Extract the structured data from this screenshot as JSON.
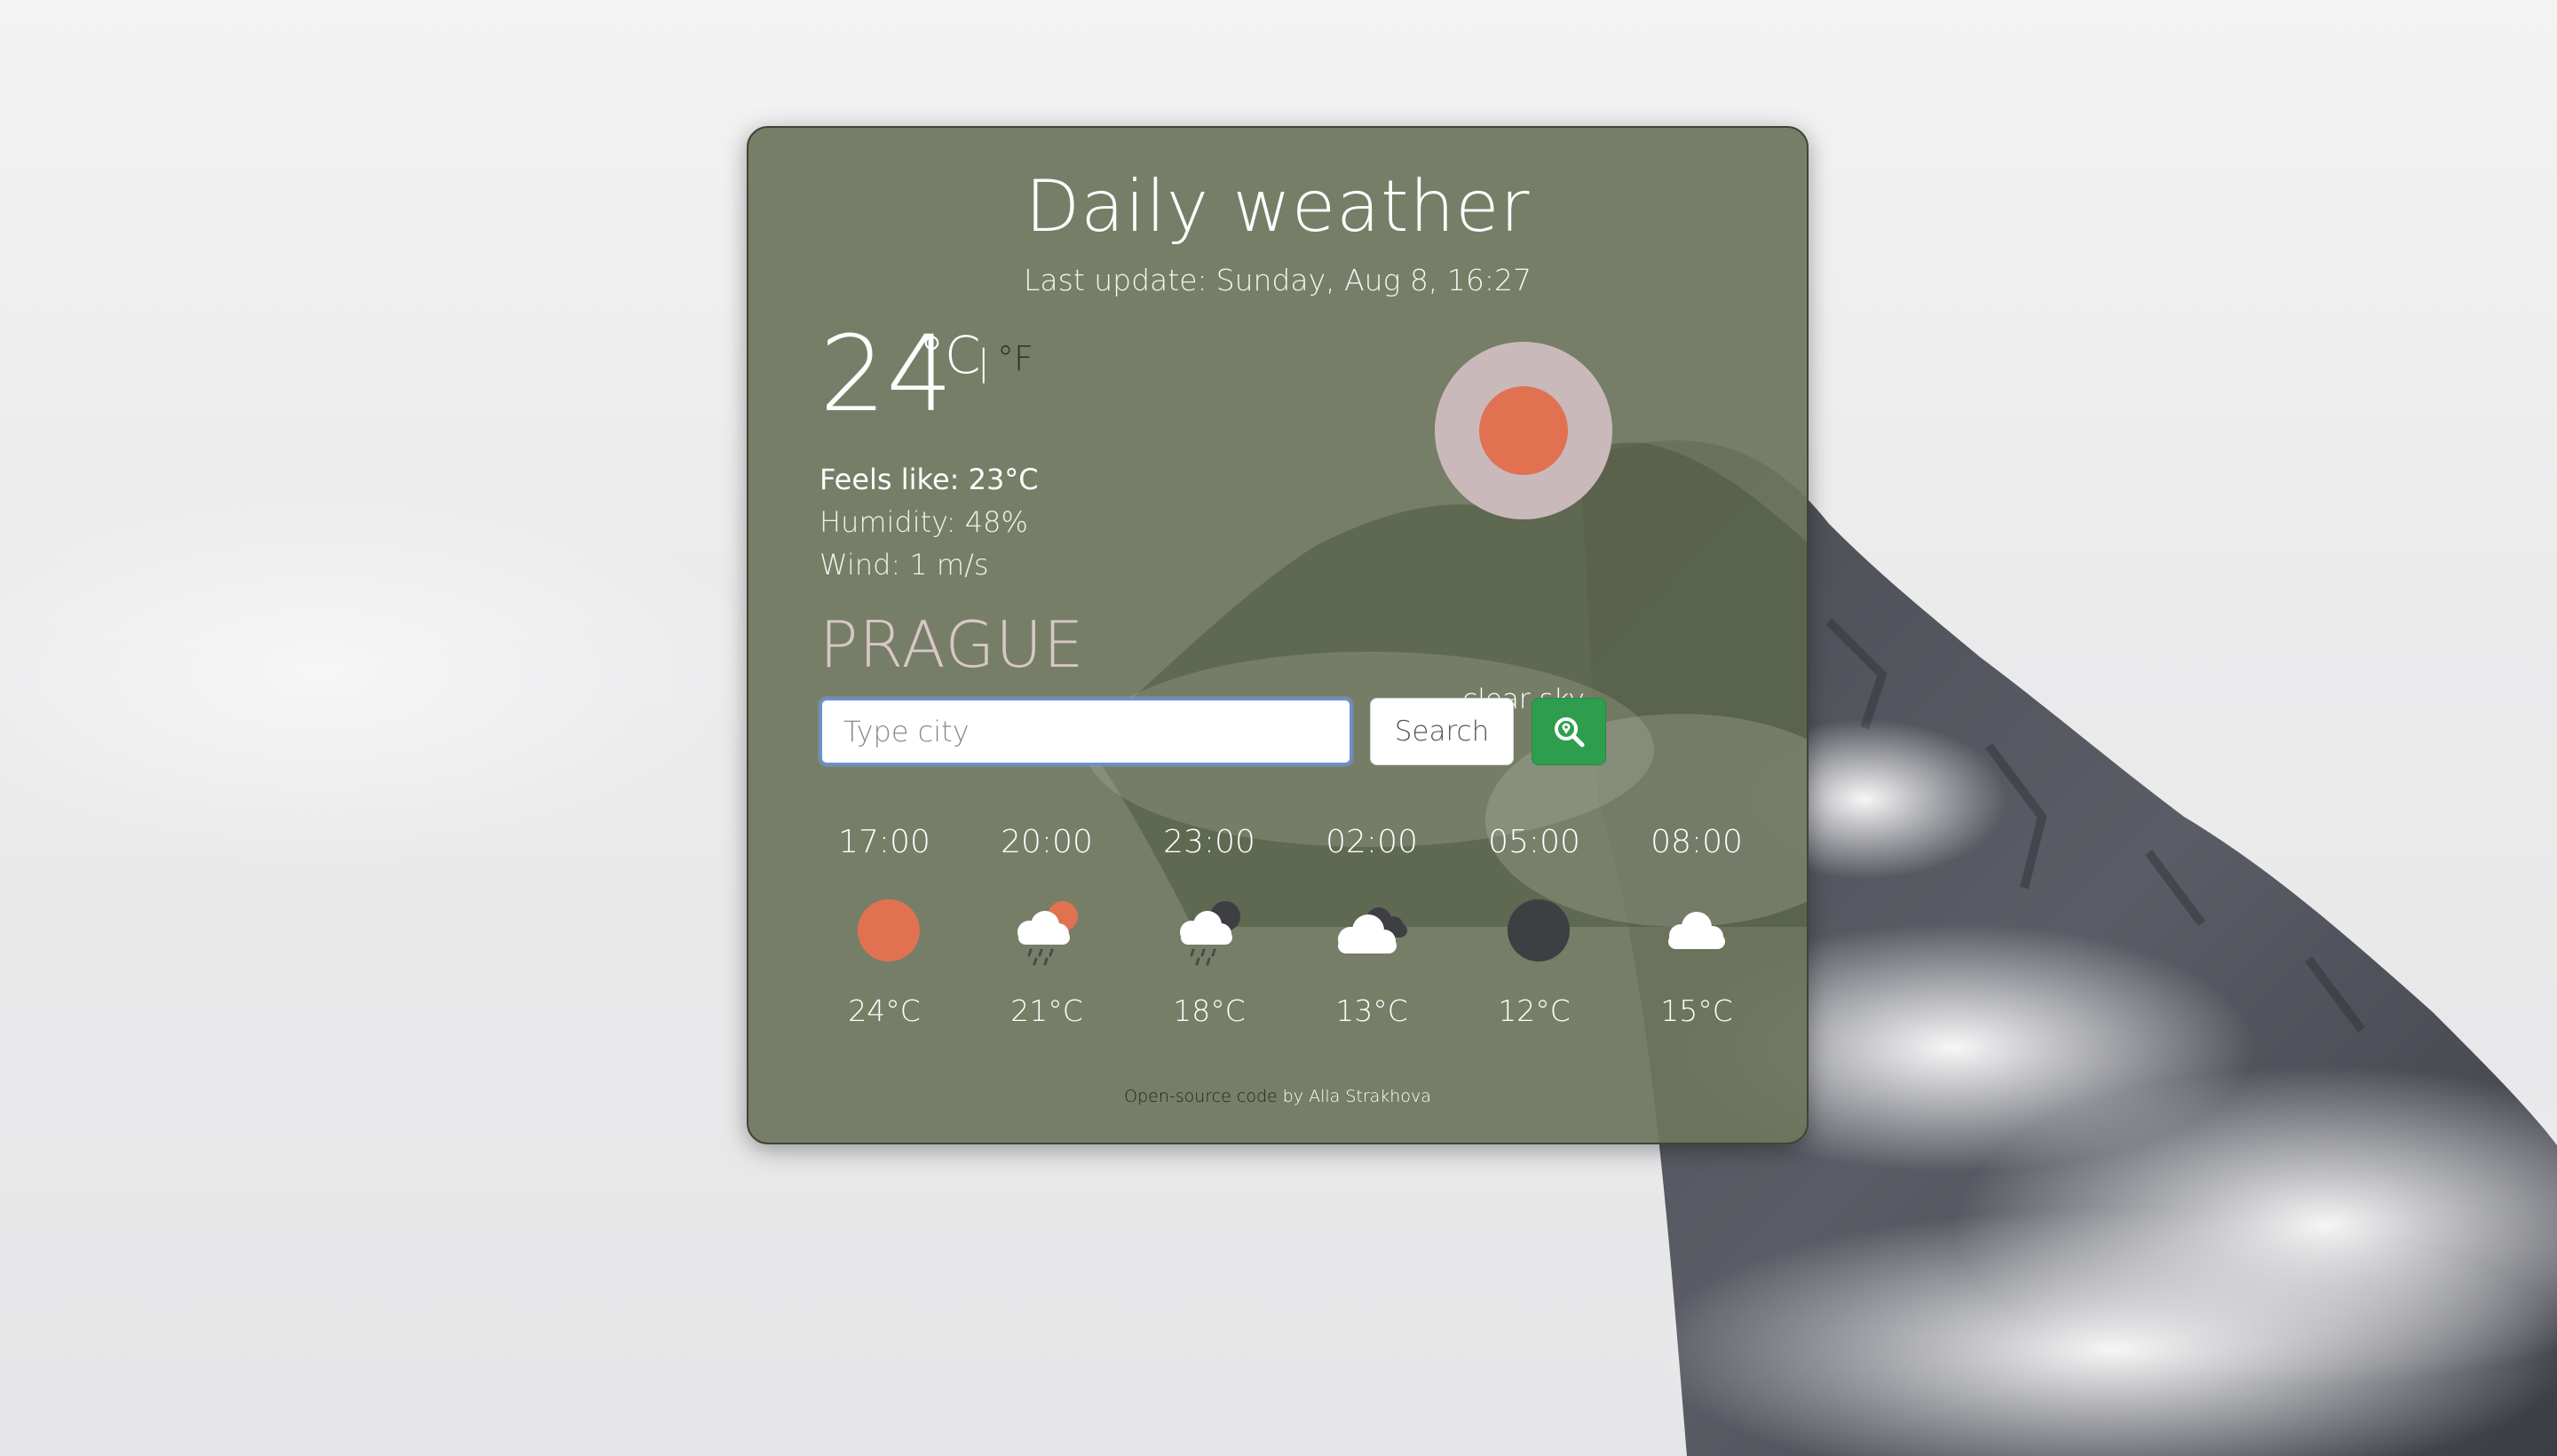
{
  "app": {
    "title": "Daily weather",
    "last_update_label": "Last update:",
    "last_update_value": "Sunday, Aug 8, 16:27"
  },
  "current": {
    "temperature": "24",
    "unit_celsius": "°C",
    "unit_separator": "|",
    "unit_fahrenheit": "°F",
    "feels_like": "Feels like: 23°C",
    "humidity": "Humidity: 48%",
    "wind": "Wind: 1 m/s",
    "description": "clear sky",
    "icon": "sun-icon"
  },
  "city": "PRAGUE",
  "search": {
    "placeholder": "Type city",
    "value": "",
    "button_label": "Search",
    "location_icon": "search-location-icon"
  },
  "forecast": [
    {
      "time": "17:00",
      "temp": "24°C",
      "icon": "sun-icon"
    },
    {
      "time": "20:00",
      "temp": "21°C",
      "icon": "rain-sun-icon"
    },
    {
      "time": "23:00",
      "temp": "18°C",
      "icon": "rain-night-icon"
    },
    {
      "time": "02:00",
      "temp": "13°C",
      "icon": "clouds-icon"
    },
    {
      "time": "05:00",
      "temp": "12°C",
      "icon": "moon-icon"
    },
    {
      "time": "08:00",
      "temp": "15°C",
      "icon": "cloud-icon"
    }
  ],
  "footer": {
    "link_text": "Open-source code",
    "author_text": "by Alla Strakhova"
  },
  "colors": {
    "card": "#6e755c",
    "sun": "#e07252",
    "halo": "#c9b9bb",
    "dark_orb": "#3e3f43",
    "button_green": "#2e9e4e",
    "city": "#d8c7c7"
  }
}
